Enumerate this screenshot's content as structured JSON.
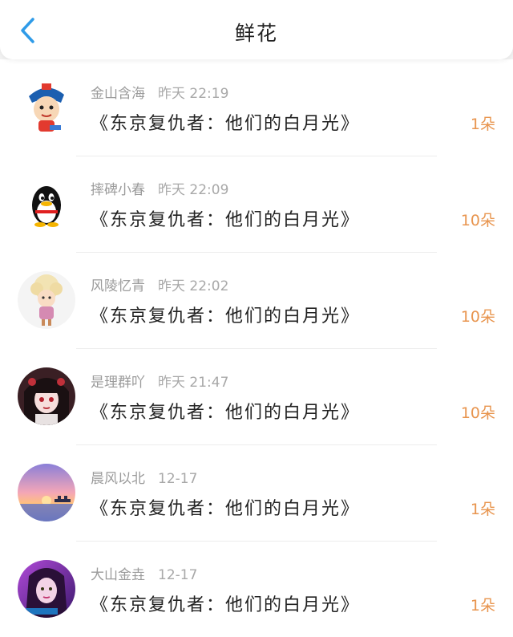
{
  "header": {
    "title": "鲜花",
    "back_icon": "chevron-left-icon",
    "accent": "#2f9be8"
  },
  "list": {
    "count_color": "#e8954f",
    "items": [
      {
        "user": "金山含海",
        "time": "昨天 22:19",
        "work": "《东京复仇者：他们的白月光》",
        "amount": "1朵",
        "avatar": "boy-hat-avatar"
      },
      {
        "user": "摔碑小春",
        "time": "昨天 22:09",
        "work": "《东京复仇者：他们的白月光》",
        "amount": "10朵",
        "avatar": "penguin-avatar"
      },
      {
        "user": "风陵忆青",
        "time": "昨天 22:02",
        "work": "《东京复仇者：他们的白月光》",
        "amount": "10朵",
        "avatar": "curly-hair-girl-avatar"
      },
      {
        "user": "是理群吖",
        "time": "昨天 21:47",
        "work": "《东京复仇者：他们的白月光》",
        "amount": "10朵",
        "avatar": "dark-hair-girl-avatar"
      },
      {
        "user": "晨风以北",
        "time": "12-17",
        "work": "《东京复仇者：他们的白月光》",
        "amount": "1朵",
        "avatar": "sunset-avatar"
      },
      {
        "user": "大山金垚",
        "time": "12-17",
        "work": "《东京复仇者：他们的白月光》",
        "amount": "1朵",
        "avatar": "purple-girl-avatar"
      }
    ]
  }
}
